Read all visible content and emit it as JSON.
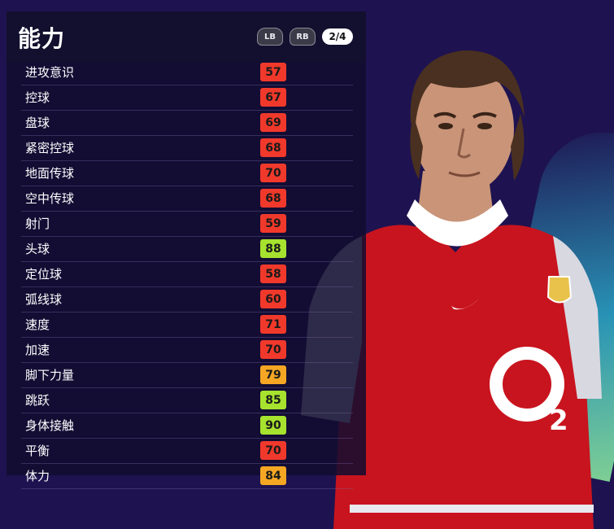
{
  "panel": {
    "title": "能力",
    "controls": {
      "lb": "LB",
      "rb": "RB",
      "page": "2/4"
    }
  },
  "stats": [
    {
      "name": "进攻意识",
      "value": "57",
      "color": "#f0392b"
    },
    {
      "name": "控球",
      "value": "67",
      "color": "#f0392b"
    },
    {
      "name": "盘球",
      "value": "69",
      "color": "#f0392b"
    },
    {
      "name": "紧密控球",
      "value": "68",
      "color": "#f0392b"
    },
    {
      "name": "地面传球",
      "value": "70",
      "color": "#f0392b"
    },
    {
      "name": "空中传球",
      "value": "68",
      "color": "#f0392b"
    },
    {
      "name": "射门",
      "value": "59",
      "color": "#f0392b"
    },
    {
      "name": "头球",
      "value": "88",
      "color": "#a6e22e"
    },
    {
      "name": "定位球",
      "value": "58",
      "color": "#f0392b"
    },
    {
      "name": "弧线球",
      "value": "60",
      "color": "#f0392b"
    },
    {
      "name": "速度",
      "value": "71",
      "color": "#f0392b"
    },
    {
      "name": "加速",
      "value": "70",
      "color": "#f0392b"
    },
    {
      "name": "脚下力量",
      "value": "79",
      "color": "#f5a623"
    },
    {
      "name": "跳跃",
      "value": "85",
      "color": "#a6e22e"
    },
    {
      "name": "身体接触",
      "value": "90",
      "color": "#a6e22e"
    },
    {
      "name": "平衡",
      "value": "70",
      "color": "#f0392b"
    },
    {
      "name": "体力",
      "value": "84",
      "color": "#f5a623"
    }
  ],
  "player_image": {
    "icon": "player-portrait"
  }
}
